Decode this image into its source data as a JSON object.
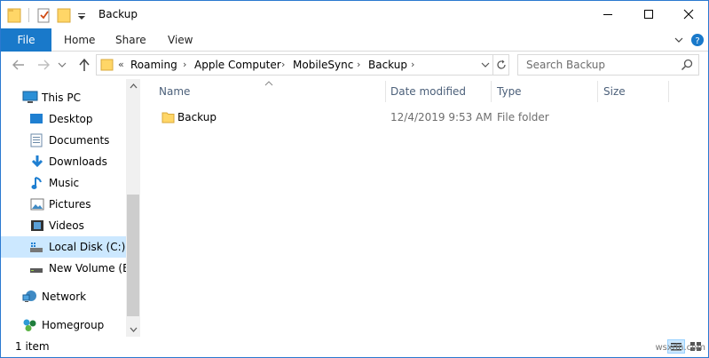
{
  "window": {
    "title": "Backup"
  },
  "ribbon": {
    "tabs": [
      {
        "label": "File"
      },
      {
        "label": "Home"
      },
      {
        "label": "Share"
      },
      {
        "label": "View"
      }
    ]
  },
  "address": {
    "overflow": "«",
    "crumbs": [
      "Roaming",
      "Apple Computer",
      "MobileSync",
      "Backup"
    ]
  },
  "search": {
    "placeholder": "Search Backup"
  },
  "navigation": {
    "items": [
      {
        "label": "This PC",
        "icon": "computer-icon"
      },
      {
        "label": "Desktop",
        "icon": "desktop-icon"
      },
      {
        "label": "Documents",
        "icon": "documents-icon"
      },
      {
        "label": "Downloads",
        "icon": "downloads-icon"
      },
      {
        "label": "Music",
        "icon": "music-icon"
      },
      {
        "label": "Pictures",
        "icon": "pictures-icon"
      },
      {
        "label": "Videos",
        "icon": "videos-icon"
      },
      {
        "label": "Local Disk (C:)",
        "icon": "local-disk-icon",
        "selected": true
      },
      {
        "label": "New Volume (E:)",
        "icon": "drive-icon"
      },
      {
        "label": "Network",
        "icon": "network-icon"
      },
      {
        "label": "Homegroup",
        "icon": "homegroup-icon"
      }
    ]
  },
  "columns": [
    {
      "label": "Name"
    },
    {
      "label": "Date modified"
    },
    {
      "label": "Type"
    },
    {
      "label": "Size"
    }
  ],
  "files": [
    {
      "name": "Backup",
      "date_modified": "12/4/2019 9:53 AM",
      "type": "File folder",
      "size": ""
    }
  ],
  "status": {
    "item_count": "1 item"
  },
  "watermark": "wsxdn.com",
  "colors": {
    "accent": "#1979ca",
    "selection": "#cce8ff",
    "folder": "#ffd667"
  }
}
